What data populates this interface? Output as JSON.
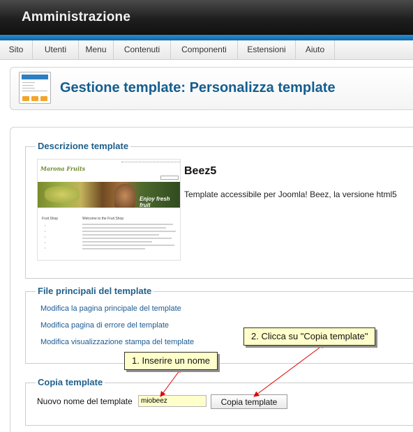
{
  "header": {
    "title": "Amministrazione"
  },
  "menu": {
    "items": [
      "Sito",
      "Utenti",
      "Menu",
      "Contenuti",
      "Componenti",
      "Estensioni",
      "Aiuto"
    ]
  },
  "page": {
    "title": "Gestione template: Personalizza template"
  },
  "description": {
    "legend": "Descrizione template",
    "template_name": "Beez5",
    "template_text": "Template accessibile per Joomla! Beez, la versione html5",
    "thumbnail": {
      "logo": "Marona Fruits",
      "banner_caption": "Enjoy fresh fruit",
      "sidebar_title": "Fruit Shop",
      "content_title": "Welcome to the Fruit Shop"
    }
  },
  "files": {
    "legend": "File principali del template",
    "links": [
      "Modifica la pagina principale del template",
      "Modifica pagina di errore del template",
      "Modifica visualizzazione stampa del template"
    ]
  },
  "copy": {
    "legend": "Copia template",
    "field_label": "Nuovo nome del template",
    "field_value": "miobeez",
    "button_label": "Copia template"
  },
  "callouts": {
    "step1": "1. Inserire un nome",
    "step2": "2. Clicca su \"Copia template\""
  },
  "colors": {
    "accent_blue": "#135e8f",
    "legend_blue": "#1f5f8b",
    "callout_bg": "#ffffcc",
    "arrow_red": "#e00000"
  }
}
